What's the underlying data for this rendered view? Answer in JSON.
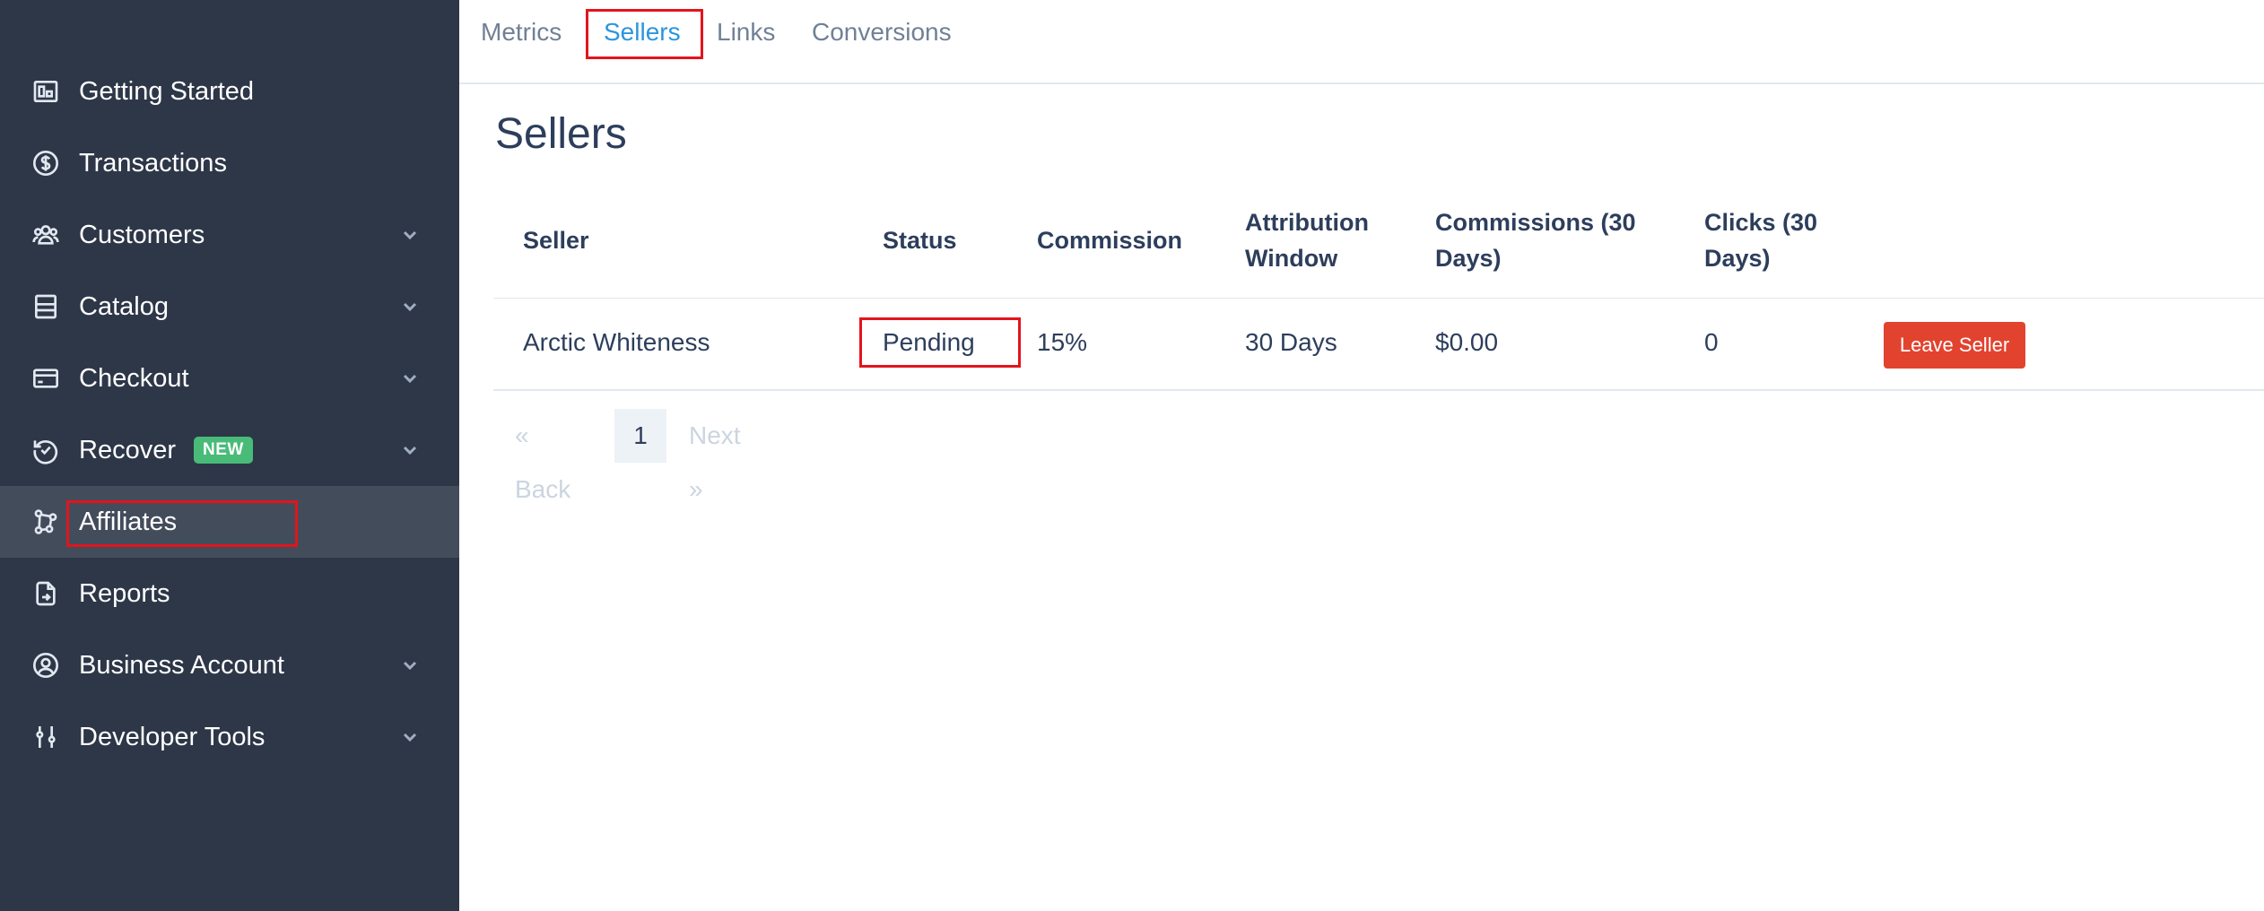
{
  "sidebar": {
    "items": [
      {
        "label": "Getting Started",
        "icon": "getting-started-icon"
      },
      {
        "label": "Transactions",
        "icon": "dollar-circle-icon"
      },
      {
        "label": "Customers",
        "icon": "users-icon"
      },
      {
        "label": "Catalog",
        "icon": "catalog-icon"
      },
      {
        "label": "Checkout",
        "icon": "credit-card-icon"
      },
      {
        "label": "Recover",
        "icon": "recover-icon",
        "badge": "NEW"
      },
      {
        "label": "Affiliates",
        "icon": "affiliates-icon"
      },
      {
        "label": "Reports",
        "icon": "reports-icon"
      },
      {
        "label": "Business Account",
        "icon": "user-circle-icon"
      },
      {
        "label": "Developer Tools",
        "icon": "sliders-icon"
      }
    ]
  },
  "tabs": [
    {
      "label": "Metrics"
    },
    {
      "label": "Sellers"
    },
    {
      "label": "Links"
    },
    {
      "label": "Conversions"
    }
  ],
  "page": {
    "title": "Sellers"
  },
  "table": {
    "headers": {
      "seller": "Seller",
      "status": "Status",
      "commission": "Commission",
      "attribution_1": "Attribution",
      "attribution_2": "Window",
      "commissions_1": "Commissions (30",
      "commissions_2": "Days)",
      "clicks_1": "Clicks (30",
      "clicks_2": "Days)"
    },
    "rows": [
      {
        "seller": "Arctic Whiteness",
        "status": "Pending",
        "commission": "15%",
        "attribution": "30 Days",
        "commissions": "$0.00",
        "clicks": "0",
        "action": "Leave Seller"
      }
    ]
  },
  "pagination": {
    "back": "« Back",
    "current": "1",
    "next": "Next »"
  },
  "colors": {
    "sidebar_bg": "#2d3748",
    "active_item_bg": "#434c5b",
    "active_tab": "#2b95e0",
    "leave_button": "#e2432f",
    "badge_new": "#48bb78",
    "highlight": "#e3141c"
  }
}
